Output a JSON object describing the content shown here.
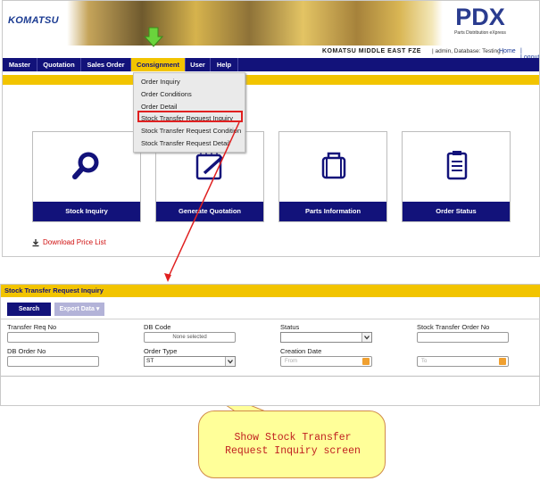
{
  "header": {
    "logo_text": "KOMATSU",
    "app_logo": "PDX",
    "app_tagline": "Parts Distribution eXpress",
    "company_name": "KOMATSU MIDDLE EAST FZE",
    "user_info": "| admin, Database: Testing |",
    "home_link": "Home",
    "logout_link": "| Logout"
  },
  "nav": {
    "items": [
      {
        "label": "Master"
      },
      {
        "label": "Quotation"
      },
      {
        "label": "Sales Order"
      },
      {
        "label": "Consignment",
        "active": true
      },
      {
        "label": "User"
      },
      {
        "label": "Help"
      }
    ]
  },
  "dropdown": {
    "items": [
      {
        "label": "Order Inquiry"
      },
      {
        "label": "Order Conditions"
      },
      {
        "label": "Order Detail"
      },
      {
        "label": "Stock Transfer Request Inquiry",
        "highlighted": true
      },
      {
        "label": "Stock Transfer Request Condition"
      },
      {
        "label": "Stock Transfer Request Detail"
      }
    ]
  },
  "tiles": [
    {
      "label": "Stock Inquiry",
      "icon": "magnifier-icon"
    },
    {
      "label": "Generate Quotation",
      "icon": "edit-document-icon"
    },
    {
      "label": "Parts Information",
      "icon": "briefcase-icon"
    },
    {
      "label": "Order Status",
      "icon": "clipboard-icon"
    }
  ],
  "download_link": "Download Price List",
  "inquiry_panel": {
    "title": "Stock Transfer Request Inquiry",
    "search_label": "Search",
    "export_label": "Export Data",
    "fields": {
      "transfer_req_no": {
        "label": "Transfer Req No",
        "value": ""
      },
      "db_code": {
        "label": "DB Code",
        "value": "None selected"
      },
      "status": {
        "label": "Status",
        "value": ""
      },
      "stock_transfer_order_no": {
        "label": "Stock Transfer Order No",
        "value": ""
      },
      "db_order_no": {
        "label": "DB Order No",
        "value": ""
      },
      "order_type": {
        "label": "Order Type",
        "value": "ST"
      },
      "creation_date": {
        "label": "Creation Date",
        "from_placeholder": "From",
        "to_placeholder": "To"
      }
    }
  },
  "callout": {
    "line1": "Show Stock Transfer",
    "line2": "Request Inquiry screen"
  },
  "colors": {
    "nav_blue": "#12127a",
    "accent_yellow": "#f2c400",
    "highlight_red": "#e02020",
    "callout_fill": "#ffff99"
  }
}
